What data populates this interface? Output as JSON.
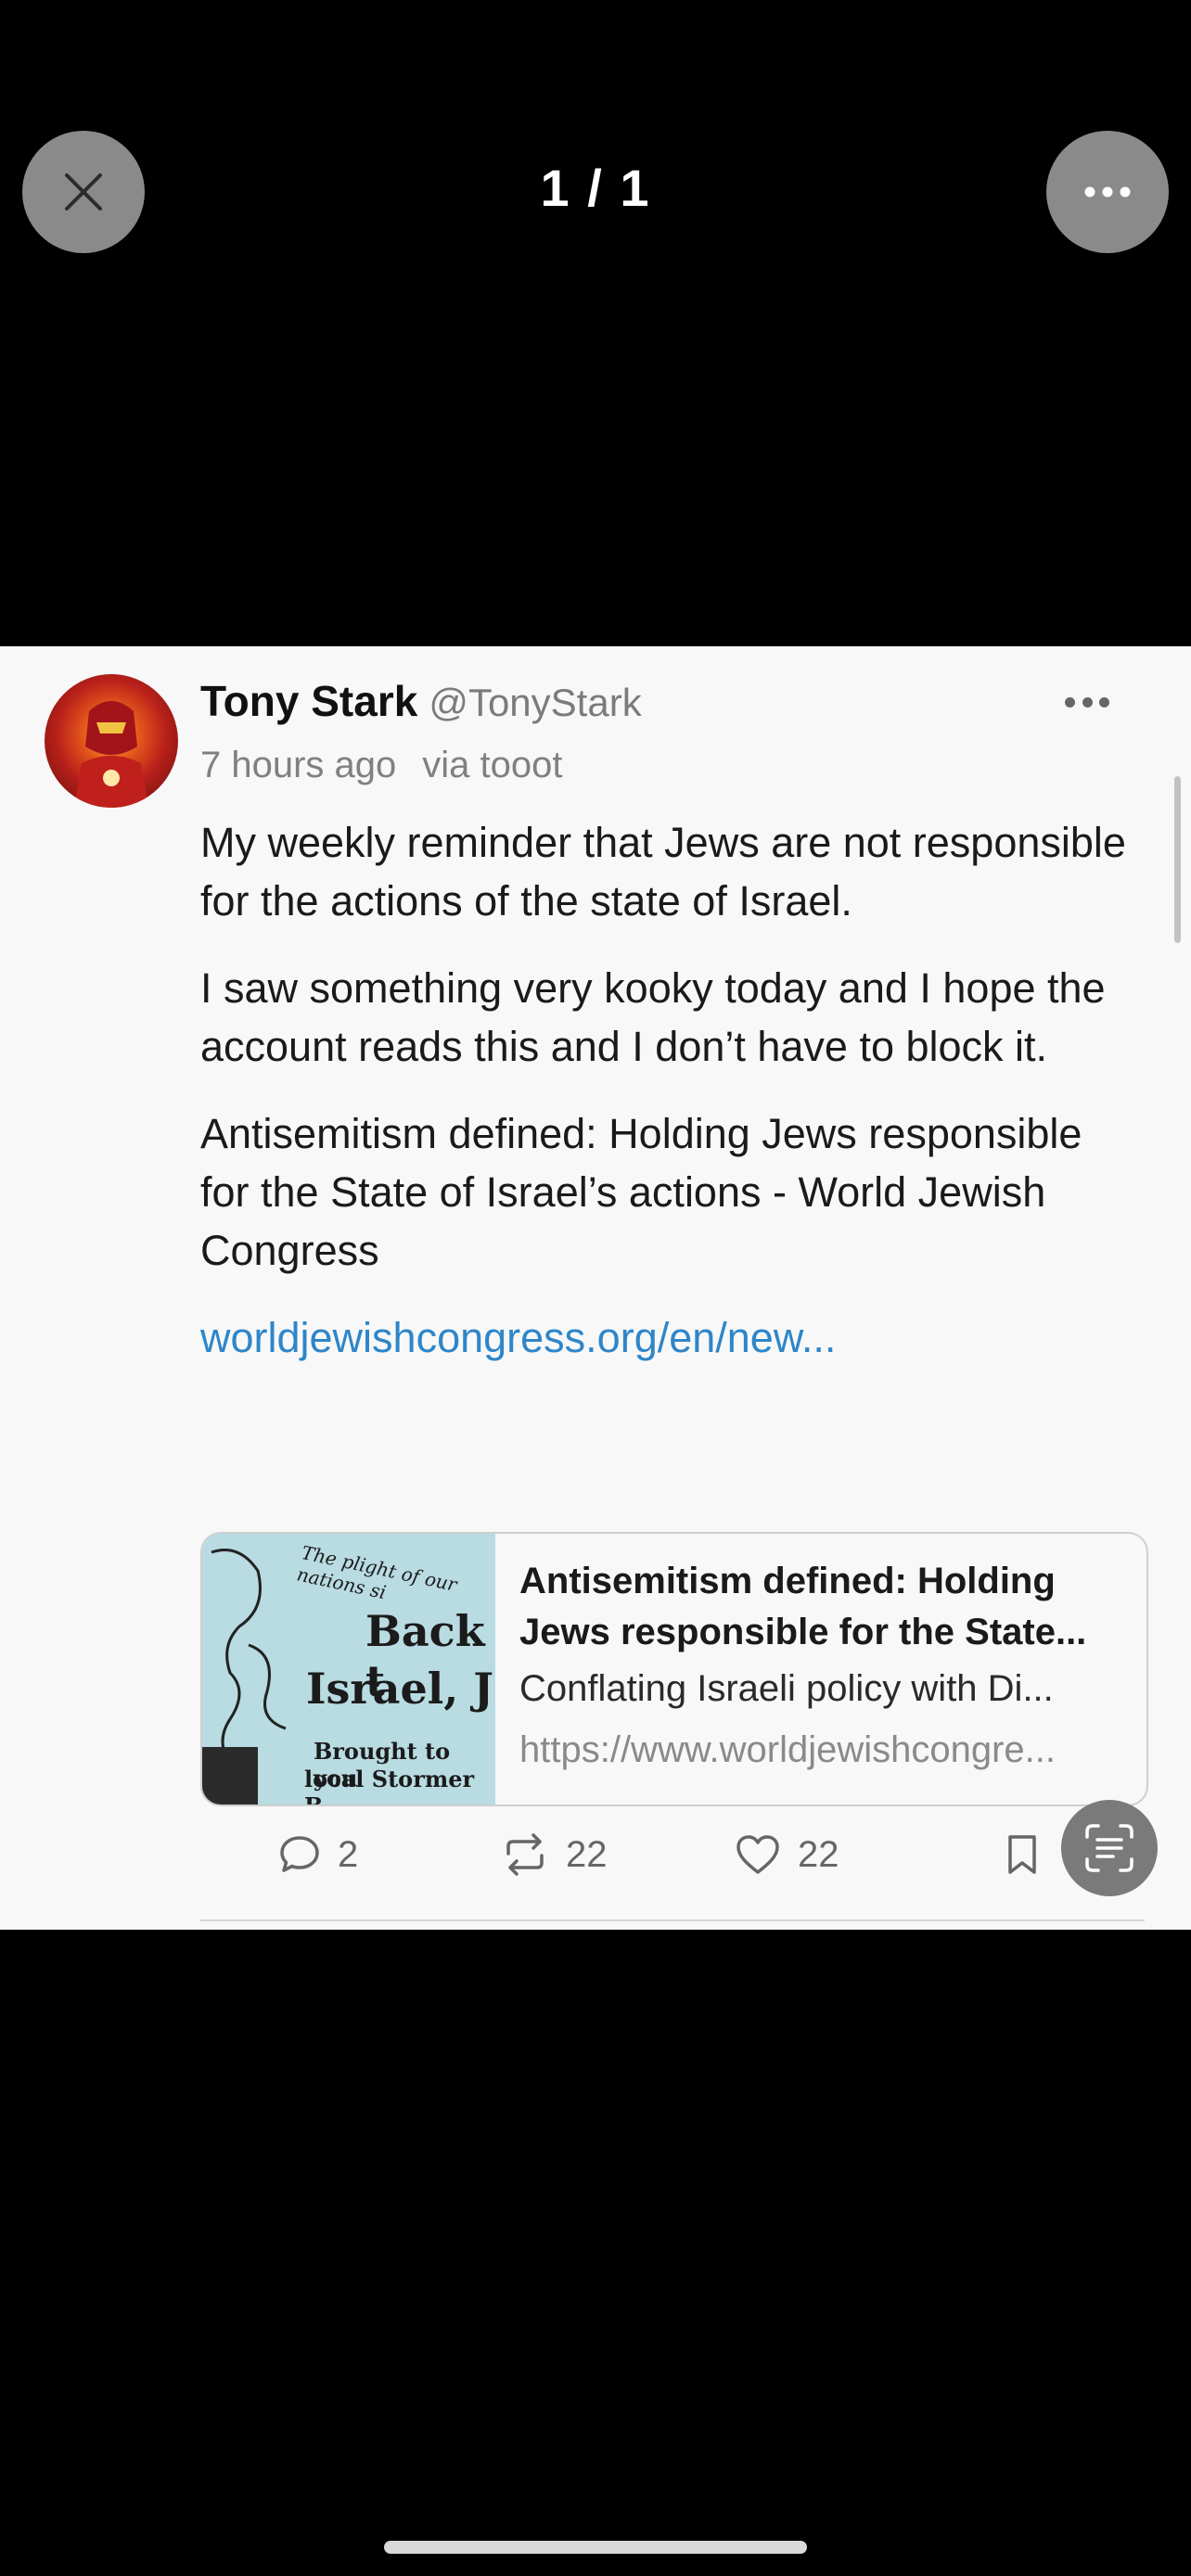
{
  "viewer": {
    "counter": "1 / 1",
    "close_icon": "close-icon",
    "more_icon": "ellipsis-icon"
  },
  "post": {
    "author_name": "Tony Stark",
    "author_handle": "@TonyStark",
    "time": "7 hours ago",
    "via": "via tooot",
    "paragraphs": [
      "My weekly reminder that Jews are not responsible for the actions of the state of Israel.",
      "I saw something very kooky today and I hope the account reads this and I don’t have to block it.",
      "Antisemitism defined: Holding Jews responsible for the State of Israel’s actions - World Jewish Congress"
    ],
    "link_text": "worldjewishcongress.org/en/new...",
    "link_card": {
      "title": "Antisemitism defined: Holding Jews responsible for the State...",
      "description": "Conflating Israeli policy with Di...",
      "url": "https://www.worldjewishcongre...",
      "thumb_lines": [
        "The plight of our nations si",
        "Back t",
        "Israel, J",
        "Brought to you",
        "local Stormer B"
      ]
    },
    "actions": {
      "replies": "2",
      "boosts": "22",
      "favourites": "22"
    }
  },
  "colors": {
    "link": "#2e86c9",
    "background": "#000000",
    "card": "#f8f8f8",
    "button": "#8a8a8a"
  }
}
